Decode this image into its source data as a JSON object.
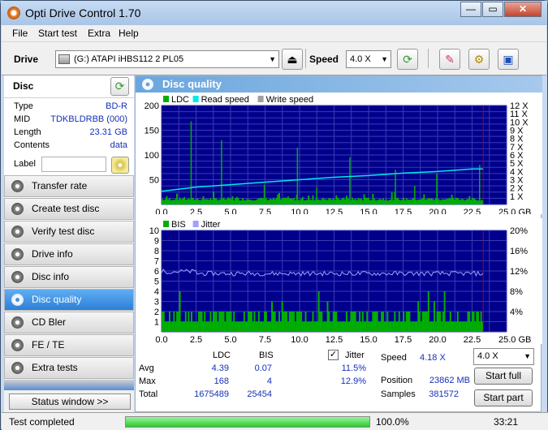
{
  "window": {
    "title": "Opti Drive Control 1.70",
    "minimize": "—",
    "maximize": "▭",
    "close": "✕"
  },
  "menu": [
    "File",
    "Start test",
    "Extra",
    "Help"
  ],
  "toolbar": {
    "drive_label": "Drive",
    "drive_value": "(G:)   ATAPI iHBS112   2 PL05",
    "speed_label": "Speed",
    "speed_value": "4.0 X"
  },
  "disc": {
    "header": "Disc",
    "rows": [
      {
        "key": "Type",
        "value": "BD-R"
      },
      {
        "key": "MID",
        "value": "TDKBLDRBB (000)"
      },
      {
        "key": "Length",
        "value": "23.31 GB"
      },
      {
        "key": "Contents",
        "value": "data"
      }
    ],
    "label_key": "Label",
    "label_value": ""
  },
  "nav": [
    "Transfer rate",
    "Create test disc",
    "Verify test disc",
    "Drive info",
    "Disc info",
    "Disc quality",
    "CD Bler",
    "FE / TE",
    "Extra tests"
  ],
  "nav_active": "Disc quality",
  "status_window": "Status window >>",
  "panel_title": "Disc quality",
  "chart_data": [
    {
      "type": "bar",
      "title": "",
      "legend": [
        "LDC",
        "Read speed",
        "Write speed"
      ],
      "colors": {
        "LDC": "#00b000",
        "Read speed": "#00e8e8",
        "Write speed": "#a0a0a0",
        "background": "#00008c",
        "grid": "#3a3ab4"
      },
      "xlim": [
        0,
        25.0
      ],
      "x_ticks": [
        "0.0",
        "2.5",
        "5.0",
        "7.5",
        "10.0",
        "12.5",
        "15.0",
        "17.5",
        "20.0",
        "22.5",
        "25.0 GB"
      ],
      "ylim": [
        0,
        200
      ],
      "y_ticks": [
        "200",
        "150",
        "100",
        "50"
      ],
      "y2_ticks": [
        "12 X",
        "11 X",
        "10 X",
        "9 X",
        "8 X",
        "7 X",
        "6 X",
        "5 X",
        "4 X",
        "3 X",
        "2 X",
        "1 X"
      ],
      "y2lim": [
        0,
        12
      ],
      "disc_end": 23.31,
      "ldc_spikes": [
        [
          2.1,
          168
        ],
        [
          4.3,
          130
        ],
        [
          9.8,
          115
        ],
        [
          13.6,
          95
        ],
        [
          16.9,
          70
        ],
        [
          19.9,
          62
        ],
        [
          23.0,
          80
        ],
        [
          7.4,
          40
        ],
        [
          11.2,
          35
        ],
        [
          18.3,
          38
        ]
      ],
      "read_speed": [
        [
          0.0,
          1.6
        ],
        [
          2.5,
          2.1
        ],
        [
          5.0,
          2.4
        ],
        [
          7.5,
          2.7
        ],
        [
          10.0,
          3.0
        ],
        [
          12.5,
          3.3
        ],
        [
          15.0,
          3.5
        ],
        [
          17.5,
          3.8
        ],
        [
          20.0,
          4.0
        ],
        [
          22.5,
          4.3
        ],
        [
          23.3,
          4.3
        ]
      ]
    },
    {
      "type": "bar",
      "title": "",
      "legend": [
        "BIS",
        "Jitter"
      ],
      "colors": {
        "BIS": "#00b000",
        "Jitter": "#a0a0ff",
        "background": "#00008c",
        "grid": "#3a3ab4"
      },
      "xlim": [
        0,
        25.0
      ],
      "x_ticks": [
        "0.0",
        "2.5",
        "5.0",
        "7.5",
        "10.0",
        "12.5",
        "15.0",
        "17.5",
        "20.0",
        "22.5",
        "25.0 GB"
      ],
      "ylim": [
        0,
        10
      ],
      "y_ticks": [
        "10",
        "9",
        "8",
        "7",
        "6",
        "5",
        "4",
        "3",
        "2",
        "1"
      ],
      "y2_ticks": [
        "20%",
        "16%",
        "12%",
        "8%",
        "4%"
      ],
      "y2lim": [
        0,
        20
      ],
      "disc_end": 23.31,
      "jitter_level": 11.5
    }
  ],
  "stats": {
    "col_ldc": "LDC",
    "col_bis": "BIS",
    "col_jitter": "Jitter",
    "avg_label": "Avg",
    "avg_ldc": "4.39",
    "avg_bis": "0.07",
    "avg_jitter": "11.5%",
    "max_label": "Max",
    "max_ldc": "168",
    "max_bis": "4",
    "max_jitter": "12.9%",
    "total_label": "Total",
    "total_ldc": "1675489",
    "total_bis": "25454",
    "speed_label": "Speed",
    "speed_value": "4.18 X",
    "position_label": "Position",
    "position_value": "23862 MB",
    "samples_label": "Samples",
    "samples_value": "381572",
    "speed_select": "4.0 X",
    "start_full": "Start full",
    "start_part": "Start part",
    "jitter_checked": "✓"
  },
  "statusbar": {
    "text": "Test completed",
    "progress": 100.0,
    "progress_text": "100.0%",
    "time": "33:21"
  }
}
